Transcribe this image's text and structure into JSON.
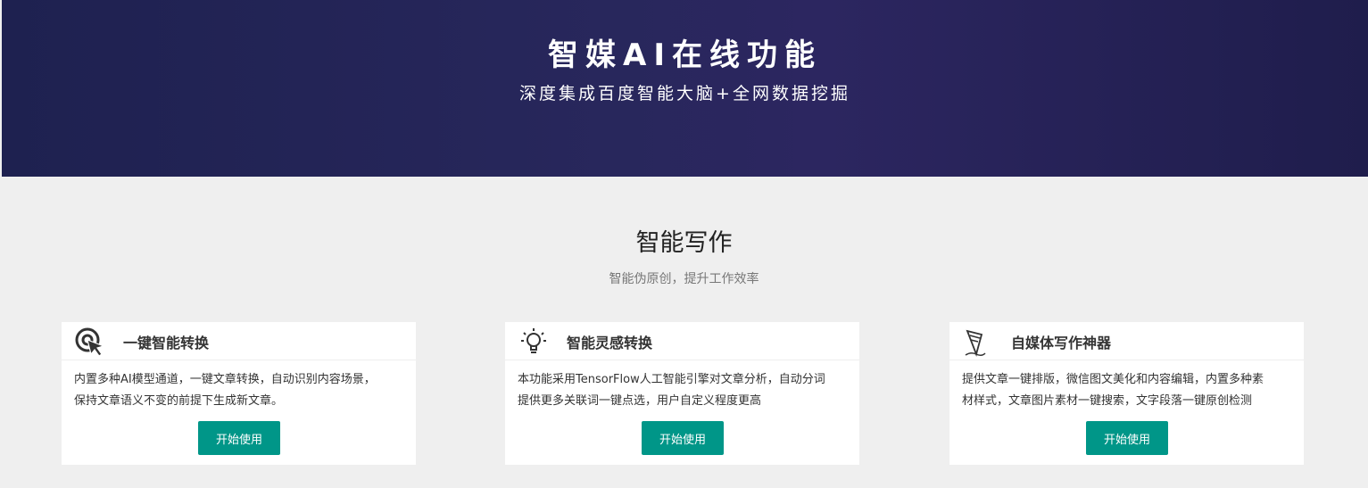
{
  "hero": {
    "title": "智媒AI在线功能",
    "subtitle": "深度集成百度智能大脑+全网数据挖掘"
  },
  "section": {
    "title": "智能写作",
    "subtitle": "智能伪原创，提升工作效率"
  },
  "cards": [
    {
      "icon": "cursor-click-icon",
      "title": "一键智能转换",
      "desc_line1": "内置多种AI模型通道，一键文章转换，自动识别内容场景，",
      "desc_line2": "保持文章语义不变的前提下生成新文章。",
      "button": "开始使用"
    },
    {
      "icon": "lightbulb-icon",
      "title": "智能灵感转换",
      "desc_line1": "本功能采用TensorFlow人工智能引擎对文章分析，自动分词",
      "desc_line2": "提供更多关联词一键点选，用户自定义程度更高",
      "button": "开始使用"
    },
    {
      "icon": "pen-writing-icon",
      "title": "自媒体写作神器",
      "desc_line1": "提供文章一键排版，微信图文美化和内容编辑，内置多种素",
      "desc_line2": "材样式，文章图片素材一键搜索，文字段落一键原创检测",
      "button": "开始使用"
    }
  ],
  "colors": {
    "hero_bg": "#28275c",
    "page_bg": "#efefef",
    "button": "#009688"
  }
}
